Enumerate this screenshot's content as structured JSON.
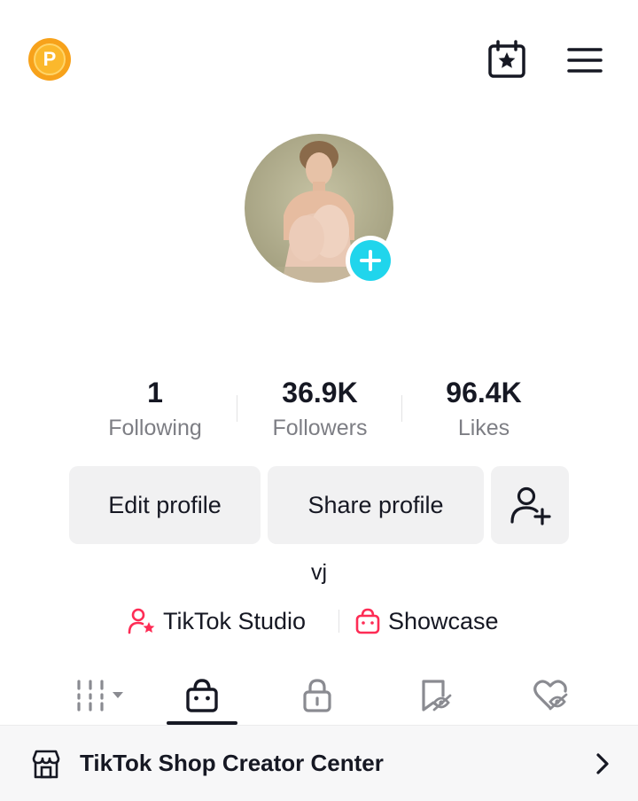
{
  "topbar": {
    "coin_letter": "P",
    "coin_icon": "coin-icon",
    "calendar_icon": "calendar-star-icon",
    "menu_icon": "hamburger-menu-icon"
  },
  "avatar": {
    "add_icon": "plus-icon"
  },
  "stats": [
    {
      "value": "1",
      "label": "Following"
    },
    {
      "value": "36.9K",
      "label": "Followers"
    },
    {
      "value": "96.4K",
      "label": "Likes"
    }
  ],
  "buttons": {
    "edit": "Edit profile",
    "share": "Share profile",
    "add_friend_icon": "add-friend-icon"
  },
  "username": "vj",
  "links": {
    "studio": "TikTok Studio",
    "showcase": "Showcase"
  },
  "tabs": [
    {
      "icon": "grid-icon",
      "active": false
    },
    {
      "icon": "shopping-bag-icon",
      "active": true
    },
    {
      "icon": "lock-icon",
      "active": false
    },
    {
      "icon": "bookmark-hidden-icon",
      "active": false
    },
    {
      "icon": "heart-hidden-icon",
      "active": false
    }
  ],
  "shop_bar": {
    "title": "TikTok Shop Creator Center"
  },
  "colors": {
    "accent_cyan": "#20d5ec",
    "accent_red": "#fe2c55",
    "coin": "#f7a21b",
    "button_bg": "#f1f1f2",
    "text": "#161823",
    "muted": "#7d7e84"
  }
}
